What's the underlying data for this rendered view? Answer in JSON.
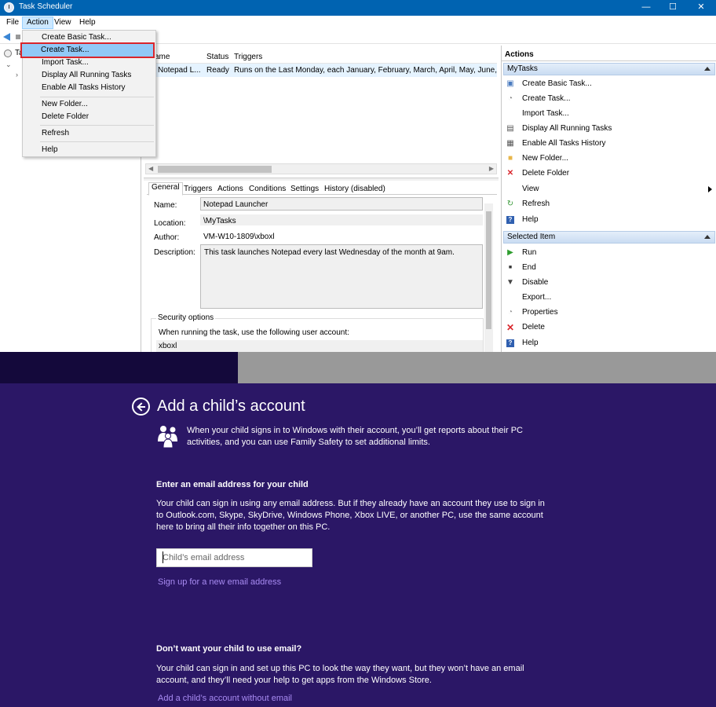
{
  "task_scheduler": {
    "window_title": "Task Scheduler",
    "window_buttons": {
      "minimize": "—",
      "maximize": "☐",
      "close": "✕"
    },
    "menu": [
      "File",
      "Action",
      "View",
      "Help"
    ],
    "tree": {
      "root_label": "Ta"
    },
    "action_menu": {
      "items": [
        {
          "label": "Create Basic Task..."
        },
        {
          "label": "Create Task..."
        },
        {
          "label": "Import Task..."
        },
        {
          "label": "Display All Running Tasks"
        },
        {
          "label": "Enable All Tasks History"
        },
        {
          "label": "New Folder..."
        },
        {
          "label": "Delete Folder"
        },
        {
          "label": "Refresh"
        },
        {
          "label": "Help"
        }
      ]
    },
    "task_list": {
      "columns": [
        "ame",
        "Status",
        "Triggers"
      ],
      "rows": [
        {
          "name": "Notepad L...",
          "status": "Ready",
          "triggers": "Runs on the Last Monday, each January, February, March, April, May, June, July"
        }
      ]
    },
    "tabs": [
      "General",
      "Triggers",
      "Actions",
      "Conditions",
      "Settings",
      "History (disabled)"
    ],
    "general": {
      "name_label": "Name:",
      "name_value": "Notepad Launcher",
      "location_label": "Location:",
      "location_value": "\\MyTasks",
      "author_label": "Author:",
      "author_value": "VM-W10-1809\\xboxl",
      "description_label": "Description:",
      "description_value": "This task launches Notepad every last Wednesday of the month at 9am.",
      "security_title": "Security options",
      "security_text": "When running the task, use the following user account:",
      "security_account": "xboxl"
    },
    "actions_pane": {
      "header": "Actions",
      "folder_section": "MyTasks",
      "folder_items": [
        {
          "label": "Create Basic Task...",
          "icon": "wizard-icon"
        },
        {
          "label": "Create Task...",
          "icon": "task-icon"
        },
        {
          "label": "Import Task...",
          "icon": ""
        },
        {
          "label": "Display All Running Tasks",
          "icon": "list-icon"
        },
        {
          "label": "Enable All Tasks History",
          "icon": "history-icon"
        },
        {
          "label": "New Folder...",
          "icon": "folder-icon"
        },
        {
          "label": "Delete Folder",
          "icon": "delete-icon"
        },
        {
          "label": "View",
          "icon": ""
        },
        {
          "label": "Refresh",
          "icon": "refresh-icon"
        },
        {
          "label": "Help",
          "icon": "help-icon"
        }
      ],
      "selected_section": "Selected Item",
      "selected_items": [
        {
          "label": "Run",
          "icon": "play-icon"
        },
        {
          "label": "End",
          "icon": "stop-icon"
        },
        {
          "label": "Disable",
          "icon": "disable-icon"
        },
        {
          "label": "Export...",
          "icon": ""
        },
        {
          "label": "Properties",
          "icon": "properties-icon"
        },
        {
          "label": "Delete",
          "icon": "delete-icon"
        },
        {
          "label": "Help",
          "icon": "help-icon"
        }
      ]
    },
    "colors": {
      "titlebar": "#0063b1",
      "menu_highlight": "#91c9f7",
      "highlight_border": "#d9262c"
    }
  },
  "family_safety": {
    "title": "Add a child’s account",
    "intro": "When your child signs in to Windows with their account, you’ll get reports about their PC activities, and you can use Family Safety to set additional limits.",
    "email_heading": "Enter an email address for your child",
    "email_text": "Your child can sign in using any email address. But if they already have an account they use to sign in to Outlook.com, Skype, SkyDrive, Windows Phone, Xbox LIVE, or another PC, use the same account here to bring all their info together on this PC.",
    "email_placeholder": "Child’s email address",
    "signup_link": "Sign up for a new email address",
    "no_email_heading": "Don’t want your child to use email?",
    "no_email_text": "Your child can sign in and set up this PC to look the way they want, but they won’t have an email account, and they’ll need your help to get apps from the Windows Store.",
    "no_email_link": "Add a child’s account without email",
    "colors": {
      "background": "#2b1766",
      "link": "#a88bf2"
    }
  }
}
